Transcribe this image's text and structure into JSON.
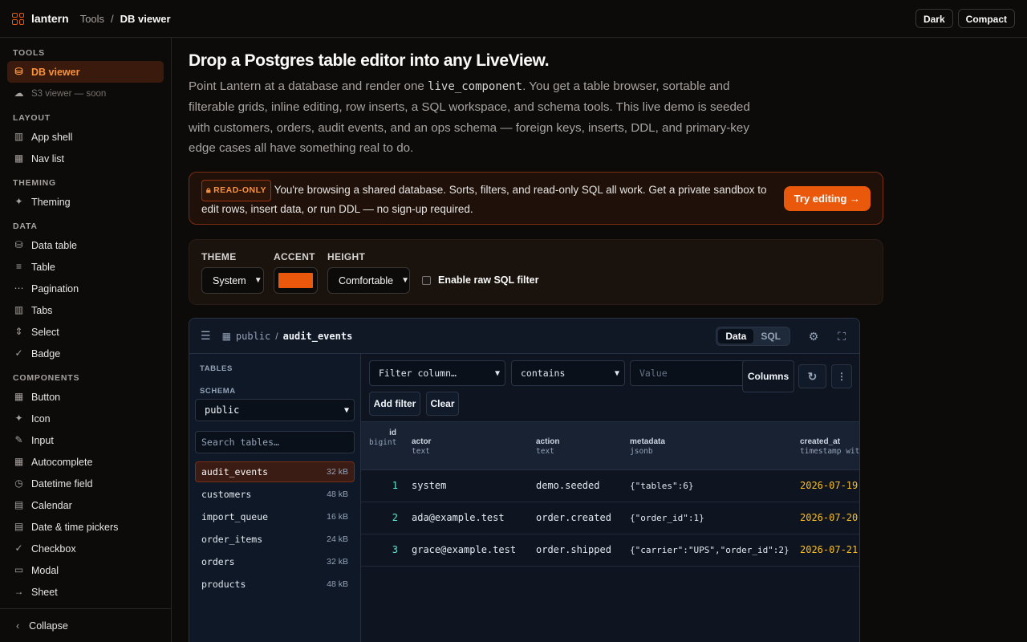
{
  "brand": {
    "name": "lantern"
  },
  "breadcrumb": {
    "parent": "Tools",
    "sep": "/",
    "current": "DB viewer"
  },
  "topbar": {
    "dark_label": "Dark",
    "compact_label": "Compact"
  },
  "sidebar": {
    "groups": [
      {
        "title": "TOOLS",
        "items": [
          {
            "label": "DB viewer",
            "icon": "database-icon",
            "active": true
          },
          {
            "label": "S3 viewer — soon",
            "icon": "cloud-icon",
            "muted": true
          }
        ]
      },
      {
        "title": "LAYOUT",
        "items": [
          {
            "label": "App shell",
            "icon": "columns-icon"
          },
          {
            "label": "Nav list",
            "icon": "grid-icon"
          }
        ]
      },
      {
        "title": "THEMING",
        "items": [
          {
            "label": "Theming",
            "icon": "sparkle-icon"
          }
        ]
      },
      {
        "title": "DATA",
        "items": [
          {
            "label": "Data table",
            "icon": "database-icon"
          },
          {
            "label": "Table",
            "icon": "rows-icon"
          },
          {
            "label": "Pagination",
            "icon": "ellipsis-icon"
          },
          {
            "label": "Tabs",
            "icon": "columns-icon"
          },
          {
            "label": "Select",
            "icon": "updown-icon"
          },
          {
            "label": "Badge",
            "icon": "check-circle-icon"
          }
        ]
      },
      {
        "title": "COMPONENTS",
        "items": [
          {
            "label": "Button",
            "icon": "grid-icon"
          },
          {
            "label": "Icon",
            "icon": "sparkle-icon"
          },
          {
            "label": "Input",
            "icon": "edit-icon"
          },
          {
            "label": "Autocomplete",
            "icon": "grid-icon"
          },
          {
            "label": "Datetime field",
            "icon": "clock-icon"
          },
          {
            "label": "Calendar",
            "icon": "calendar-icon"
          },
          {
            "label": "Date & time pickers",
            "icon": "calendar-icon"
          },
          {
            "label": "Checkbox",
            "icon": "check-circle-icon"
          },
          {
            "label": "Modal",
            "icon": "window-icon"
          },
          {
            "label": "Sheet",
            "icon": "arrow-right-icon"
          }
        ]
      }
    ],
    "collapse_label": "Collapse"
  },
  "hero": {
    "title": "Drop a Postgres table editor into any LiveView.",
    "lede_a": "Point Lantern at a database and render one ",
    "lede_code": "live_component",
    "lede_b": ". You get a table browser, sortable and filterable grids, inline editing, row inserts, a SQL workspace, and schema tools. This live demo is seeded with customers, orders, audit events, and an ops schema — foreign keys, inserts, DDL, and primary-key edge cases all have something real to do."
  },
  "banner": {
    "badge": "READ-ONLY",
    "badge_icon": "lock-icon",
    "text": "You're browsing a shared database. Sorts, filters, and read-only SQL all work. Get a private sandbox to edit rows, insert data, or run DDL — no sign-up required.",
    "cta": "Try editing →"
  },
  "controls": {
    "theme_label": "THEME",
    "theme_value": "System",
    "accent_label": "ACCENT",
    "accent_color": "#ea580c",
    "height_label": "HEIGHT",
    "height_value": "Comfortable",
    "raw_sql_label": "Enable raw SQL filter",
    "raw_sql_checked": false
  },
  "viewer": {
    "schema": "public",
    "sep": "/",
    "table": "audit_events",
    "view_tabs": [
      {
        "label": "Data",
        "active": true
      },
      {
        "label": "SQL",
        "active": false
      }
    ],
    "tables_label": "TABLES",
    "schema_label": "SCHEMA",
    "schema_value": "public",
    "search_placeholder": "Search tables…",
    "tables": [
      {
        "name": "audit_events",
        "size": "32 kB",
        "active": true
      },
      {
        "name": "customers",
        "size": "48 kB"
      },
      {
        "name": "import_queue",
        "size": "16 kB"
      },
      {
        "name": "order_items",
        "size": "24 kB"
      },
      {
        "name": "orders",
        "size": "32 kB"
      },
      {
        "name": "products",
        "size": "48 kB"
      }
    ],
    "filter": {
      "column_placeholder": "Filter column…",
      "operator": "contains",
      "value_placeholder": "Value",
      "columns_label": "Columns",
      "add_filter_label": "Add filter",
      "clear_label": "Clear"
    },
    "columns": [
      {
        "name": "id",
        "type": "bigint"
      },
      {
        "name": "actor",
        "type": "text"
      },
      {
        "name": "action",
        "type": "text"
      },
      {
        "name": "metadata",
        "type": "jsonb"
      },
      {
        "name": "created_at",
        "type": "timestamp wit"
      }
    ],
    "rows": [
      {
        "id": "1",
        "actor": "system",
        "action": "demo.seeded",
        "metadata": "{\"tables\":6}",
        "created_at": "2026-07-19"
      },
      {
        "id": "2",
        "actor": "ada@example.test",
        "action": "order.created",
        "metadata": "{\"order_id\":1}",
        "created_at": "2026-07-20"
      },
      {
        "id": "3",
        "actor": "grace@example.test",
        "action": "order.shipped",
        "metadata": "{\"carrier\":\"UPS\",\"order_id\":2}",
        "created_at": "2026-07-21"
      }
    ]
  }
}
